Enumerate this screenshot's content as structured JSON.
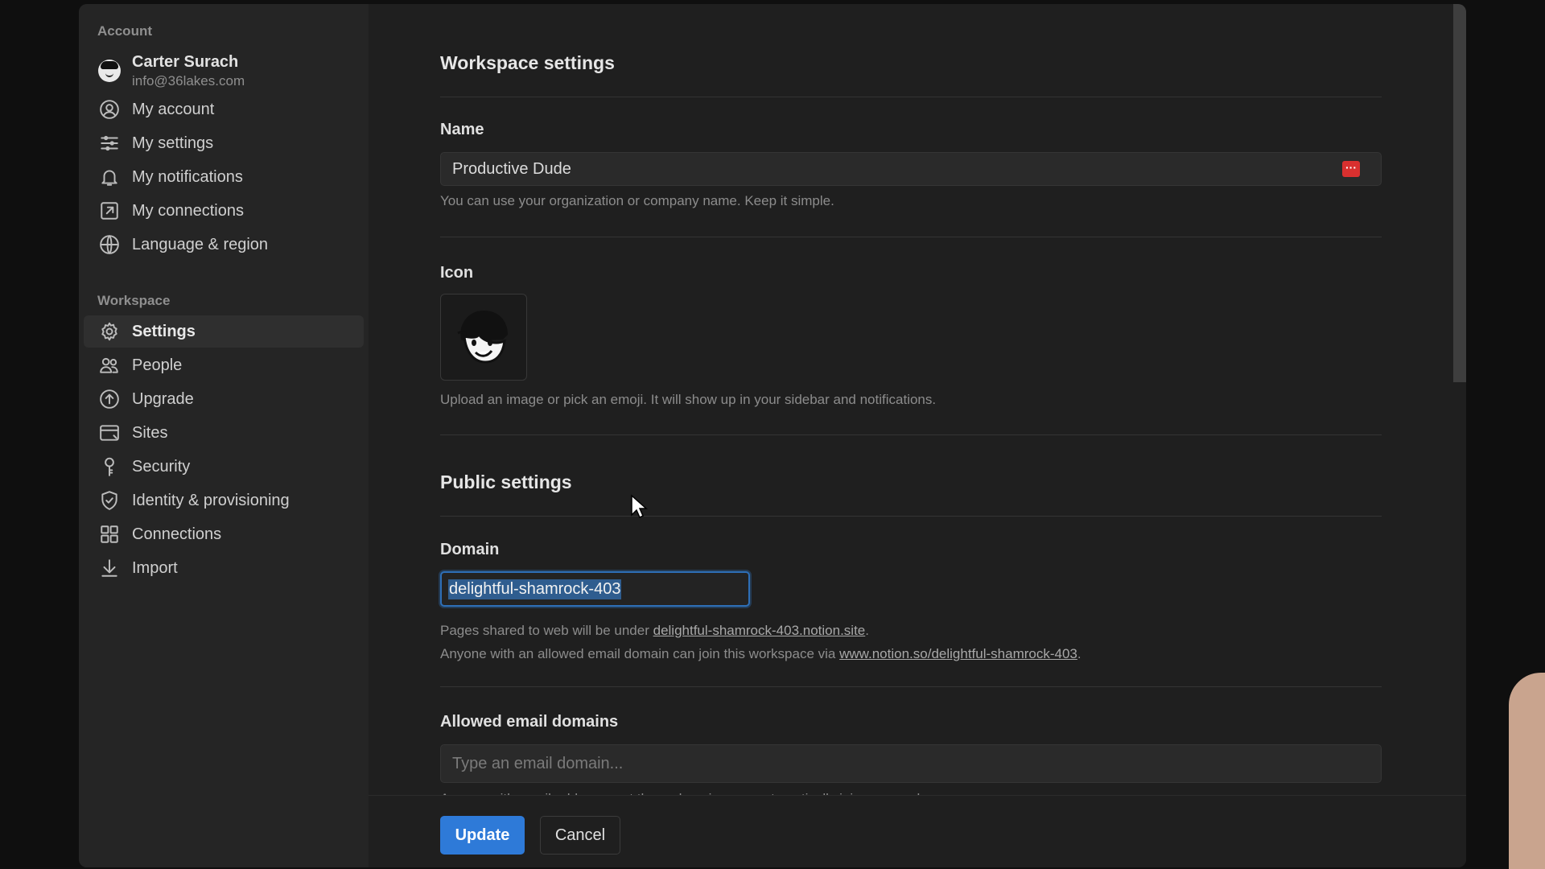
{
  "sidebar": {
    "account_heading": "Account",
    "profile": {
      "name": "Carter Surach",
      "email": "info@36lakes.com"
    },
    "account_items": [
      {
        "label": "My account",
        "icon": "user-circle-icon"
      },
      {
        "label": "My settings",
        "icon": "sliders-icon"
      },
      {
        "label": "My notifications",
        "icon": "bell-icon"
      },
      {
        "label": "My connections",
        "icon": "external-link-icon"
      },
      {
        "label": "Language & region",
        "icon": "globe-icon"
      }
    ],
    "workspace_heading": "Workspace",
    "workspace_items": [
      {
        "label": "Settings",
        "icon": "gear-icon",
        "active": true
      },
      {
        "label": "People",
        "icon": "people-icon"
      },
      {
        "label": "Upgrade",
        "icon": "upgrade-icon"
      },
      {
        "label": "Sites",
        "icon": "sites-icon"
      },
      {
        "label": "Security",
        "icon": "key-icon"
      },
      {
        "label": "Identity & provisioning",
        "icon": "shield-icon"
      },
      {
        "label": "Connections",
        "icon": "grid-icon"
      },
      {
        "label": "Import",
        "icon": "download-icon"
      }
    ]
  },
  "main": {
    "title": "Workspace settings",
    "name_label": "Name",
    "name_value": "Productive Dude",
    "name_help": "You can use your organization or company name. Keep it simple.",
    "icon_label": "Icon",
    "icon_help": "Upload an image or pick an emoji. It will show up in your sidebar and notifications.",
    "public_title": "Public settings",
    "domain_label": "Domain",
    "domain_value": "delightful-shamrock-403",
    "domain_help1_prefix": "Pages shared to web will be under ",
    "domain_help1_link": "delightful-shamrock-403.notion.site",
    "domain_help1_suffix": ".",
    "domain_help2_prefix": "Anyone with an allowed email domain can join this workspace via ",
    "domain_help2_link": "www.notion.so/delightful-shamrock-403",
    "domain_help2_suffix": ".",
    "allowed_label": "Allowed email domains",
    "allowed_placeholder": "Type an email domain...",
    "allowed_help": "Anyone with email addresses at these domains can automatically join your workspace."
  },
  "footer": {
    "update_label": "Update",
    "cancel_label": "Cancel"
  },
  "colors": {
    "accent": "#2e7ad8",
    "focus_ring": "#2e6fb7",
    "background": "#1f1f1f",
    "sidebar": "#252525"
  }
}
